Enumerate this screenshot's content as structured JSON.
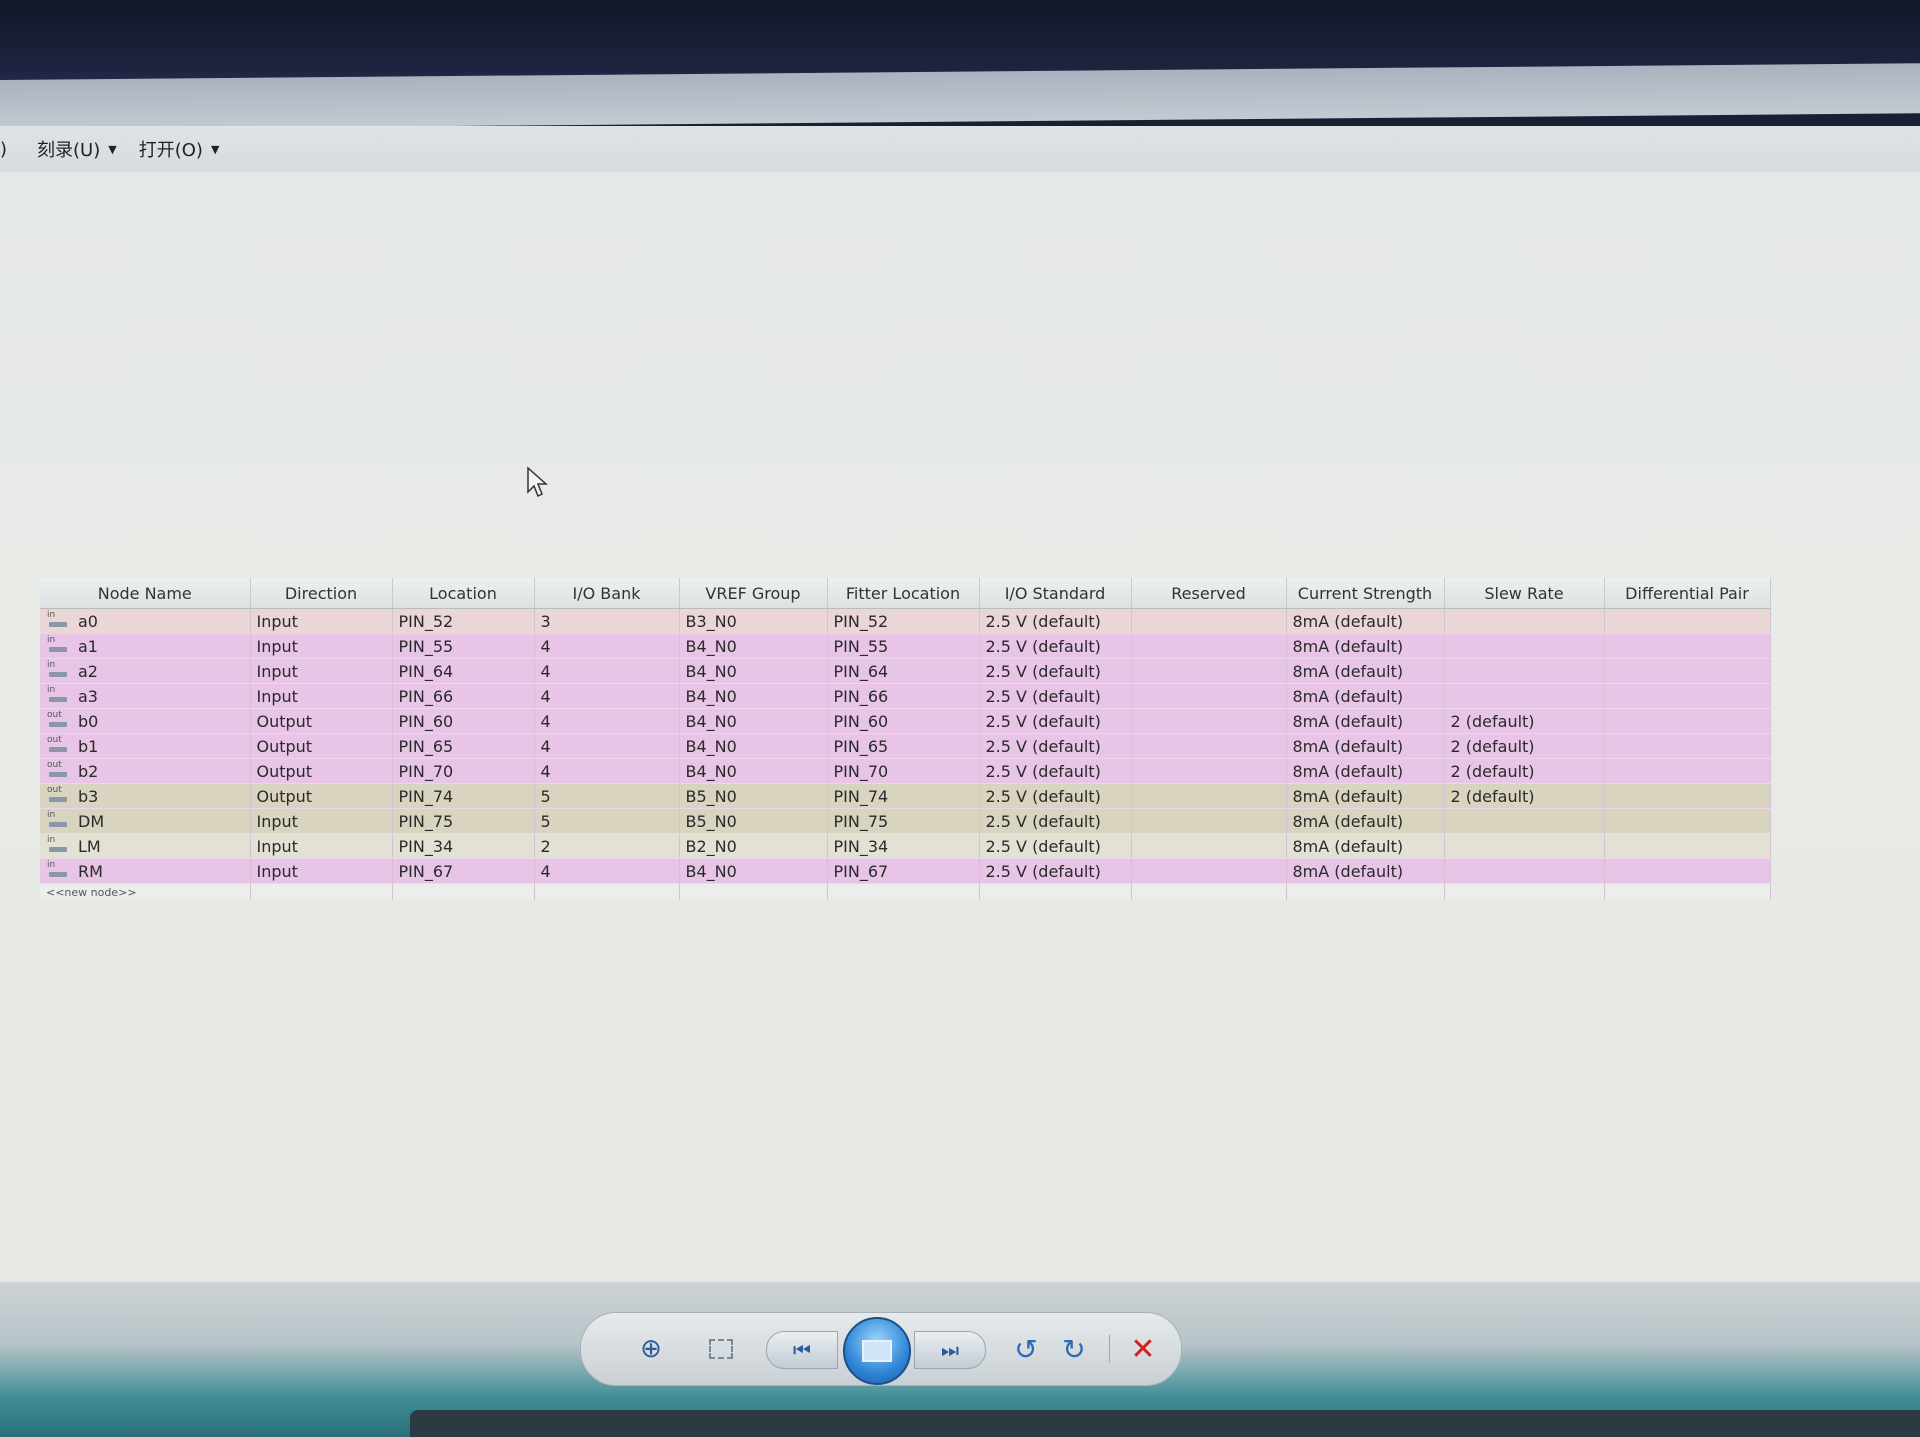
{
  "toolbar": {
    "lead_char": ")",
    "burn_label": "刻录(U)",
    "open_label": "打开(O)"
  },
  "pin_table": {
    "headers": [
      "Node Name",
      "Direction",
      "Location",
      "I/O Bank",
      "VREF Group",
      "Fitter Location",
      "I/O Standard",
      "Reserved",
      "Current Strength",
      "Slew Rate",
      "Differential Pair"
    ],
    "rows": [
      {
        "dir_tag": "in",
        "node": "a0",
        "direction": "Input",
        "location": "PIN_52",
        "bank": "3",
        "vref": "B3_N0",
        "fitter": "PIN_52",
        "standard": "2.5 V (default)",
        "reserved": "",
        "current": "8mA (default)",
        "slew": "",
        "diff": ""
      },
      {
        "dir_tag": "in",
        "node": "a1",
        "direction": "Input",
        "location": "PIN_55",
        "bank": "4",
        "vref": "B4_N0",
        "fitter": "PIN_55",
        "standard": "2.5 V (default)",
        "reserved": "",
        "current": "8mA (default)",
        "slew": "",
        "diff": ""
      },
      {
        "dir_tag": "in",
        "node": "a2",
        "direction": "Input",
        "location": "PIN_64",
        "bank": "4",
        "vref": "B4_N0",
        "fitter": "PIN_64",
        "standard": "2.5 V (default)",
        "reserved": "",
        "current": "8mA (default)",
        "slew": "",
        "diff": ""
      },
      {
        "dir_tag": "in",
        "node": "a3",
        "direction": "Input",
        "location": "PIN_66",
        "bank": "4",
        "vref": "B4_N0",
        "fitter": "PIN_66",
        "standard": "2.5 V (default)",
        "reserved": "",
        "current": "8mA (default)",
        "slew": "",
        "diff": ""
      },
      {
        "dir_tag": "out",
        "node": "b0",
        "direction": "Output",
        "location": "PIN_60",
        "bank": "4",
        "vref": "B4_N0",
        "fitter": "PIN_60",
        "standard": "2.5 V (default)",
        "reserved": "",
        "current": "8mA (default)",
        "slew": "2 (default)",
        "diff": ""
      },
      {
        "dir_tag": "out",
        "node": "b1",
        "direction": "Output",
        "location": "PIN_65",
        "bank": "4",
        "vref": "B4_N0",
        "fitter": "PIN_65",
        "standard": "2.5 V (default)",
        "reserved": "",
        "current": "8mA (default)",
        "slew": "2 (default)",
        "diff": ""
      },
      {
        "dir_tag": "out",
        "node": "b2",
        "direction": "Output",
        "location": "PIN_70",
        "bank": "4",
        "vref": "B4_N0",
        "fitter": "PIN_70",
        "standard": "2.5 V (default)",
        "reserved": "",
        "current": "8mA (default)",
        "slew": "2 (default)",
        "diff": ""
      },
      {
        "dir_tag": "out",
        "node": "b3",
        "direction": "Output",
        "location": "PIN_74",
        "bank": "5",
        "vref": "B5_N0",
        "fitter": "PIN_74",
        "standard": "2.5 V (default)",
        "reserved": "",
        "current": "8mA (default)",
        "slew": "2 (default)",
        "diff": ""
      },
      {
        "dir_tag": "in",
        "node": "DM",
        "direction": "Input",
        "location": "PIN_75",
        "bank": "5",
        "vref": "B5_N0",
        "fitter": "PIN_75",
        "standard": "2.5 V (default)",
        "reserved": "",
        "current": "8mA (default)",
        "slew": "",
        "diff": ""
      },
      {
        "dir_tag": "in",
        "node": "LM",
        "direction": "Input",
        "location": "PIN_34",
        "bank": "2",
        "vref": "B2_N0",
        "fitter": "PIN_34",
        "standard": "2.5 V (default)",
        "reserved": "",
        "current": "8mA (default)",
        "slew": "",
        "diff": ""
      },
      {
        "dir_tag": "in",
        "node": "RM",
        "direction": "Input",
        "location": "PIN_67",
        "bank": "4",
        "vref": "B4_N0",
        "fitter": "PIN_67",
        "standard": "2.5 V (default)",
        "reserved": "",
        "current": "8mA (default)",
        "slew": "",
        "diff": ""
      }
    ],
    "new_node_label": "<<new node>>"
  },
  "viewer": {
    "zoom_icon": "zoom-icon",
    "fit_icon": "actual-size-icon",
    "prev_icon": "previous-icon",
    "slideshow_icon": "slideshow-icon",
    "next_icon": "next-icon",
    "rotate_left_icon": "rotate-ccw-icon",
    "rotate_right_icon": "rotate-cw-icon",
    "delete_icon": "delete-icon",
    "zoom_glyph": "⊕",
    "prev_glyph": "⏮",
    "next_glyph": "⏭",
    "rotl_glyph": "↺",
    "rotr_glyph": "↻",
    "delete_glyph": "✕"
  },
  "colors": {
    "row_pink": "#e8c4e6",
    "row_peach": "#ead6d4",
    "row_olive": "#d9d4bf",
    "row_light": "#e3e1d4",
    "delete_red": "#d21f1f"
  }
}
